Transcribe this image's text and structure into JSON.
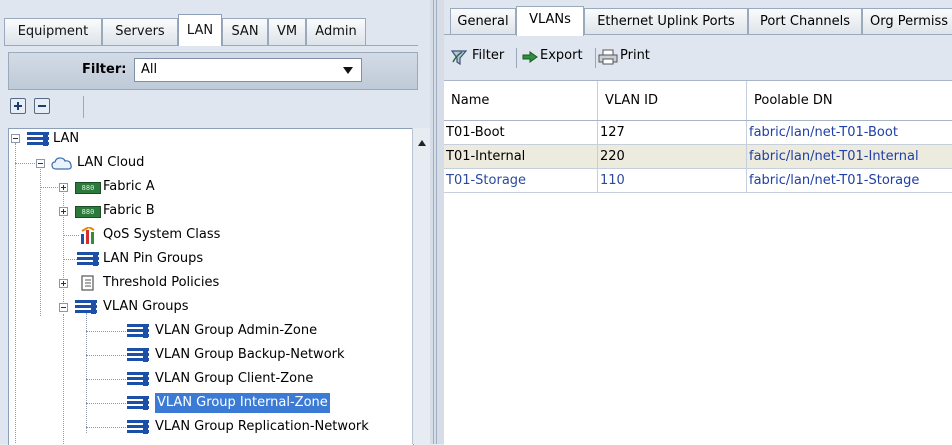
{
  "nav_tabs": [
    "Equipment",
    "Servers",
    "LAN",
    "SAN",
    "VM",
    "Admin"
  ],
  "nav_active": "LAN",
  "filter": {
    "label": "Filter:",
    "value": "All"
  },
  "tree": [
    {
      "label": "LAN"
    },
    {
      "label": "LAN Cloud"
    },
    {
      "label": "Fabric A",
      "badge": "880"
    },
    {
      "label": "Fabric B",
      "badge": "880"
    },
    {
      "label": "QoS System Class"
    },
    {
      "label": "LAN Pin Groups"
    },
    {
      "label": "Threshold Policies"
    },
    {
      "label": "VLAN Groups"
    },
    {
      "label": "VLAN Group Admin-Zone"
    },
    {
      "label": "VLAN Group Backup-Network"
    },
    {
      "label": "VLAN Group Client-Zone"
    },
    {
      "label": "VLAN Group Internal-Zone",
      "selected": true
    },
    {
      "label": "VLAN Group Replication-Network"
    }
  ],
  "right_tabs": [
    "General",
    "VLANs",
    "Ethernet Uplink Ports",
    "Port Channels",
    "Org Permiss"
  ],
  "right_active": "VLANs",
  "toolbar": {
    "filter": "Filter",
    "export": "Export",
    "print": "Print"
  },
  "table": {
    "columns": [
      "Name",
      "VLAN ID",
      "Poolable DN"
    ],
    "rows": [
      [
        "T01-Boot",
        "127",
        "fabric/lan/net-T01-Boot"
      ],
      [
        "T01-Internal",
        "220",
        "fabric/lan/net-T01-Internal"
      ],
      [
        "T01-Storage",
        "110",
        "fabric/lan/net-T01-Storage"
      ]
    ]
  }
}
